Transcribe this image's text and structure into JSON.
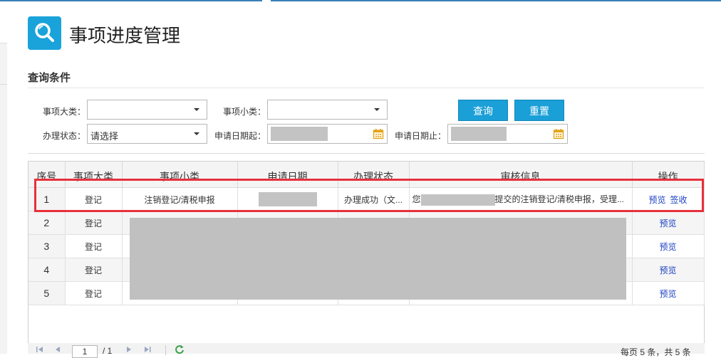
{
  "page_title": "事项进度管理",
  "section_title": "查询条件",
  "filters": {
    "category_label": "事项大类：",
    "category_value": "",
    "subcategory_label": "事项小类：",
    "subcategory_value": "",
    "status_label": "办理状态：",
    "status_value": "请选择",
    "date_start_label": "申请日期起：",
    "date_end_label": "申请日期止："
  },
  "buttons": {
    "query": "查询",
    "reset": "重置"
  },
  "table": {
    "headers": [
      "序号",
      "事项大类",
      "事项小类",
      "申请日期",
      "办理状态",
      "审核信息",
      "操作"
    ],
    "rows": [
      {
        "num": "1",
        "category": "登记",
        "subcategory": "注销登记/清税申报",
        "status": "办理成功（文...",
        "info_prefix": "您",
        "info_suffix": "提交的注销登记/清税申报，受理...",
        "actions": [
          "预览",
          "签收"
        ]
      },
      {
        "num": "2",
        "category": "登记",
        "actions": [
          "预览"
        ]
      },
      {
        "num": "3",
        "category": "登记",
        "actions": [
          "预览"
        ]
      },
      {
        "num": "4",
        "category": "登记",
        "actions": [
          "预览"
        ]
      },
      {
        "num": "5",
        "category": "登记",
        "actions": [
          "预览"
        ]
      }
    ]
  },
  "pager": {
    "page_value": "1",
    "page_total": "/ 1",
    "summary": "每页 5 条，共 5 条"
  },
  "colors": {
    "accent": "#1a9fd7",
    "highlight": "#e8303a",
    "link": "#1a3fc4"
  },
  "icons": [
    "search-icon",
    "calendar-icon",
    "caret-down-icon",
    "refresh-icon",
    "first-page-icon",
    "prev-page-icon",
    "next-page-icon",
    "last-page-icon"
  ]
}
